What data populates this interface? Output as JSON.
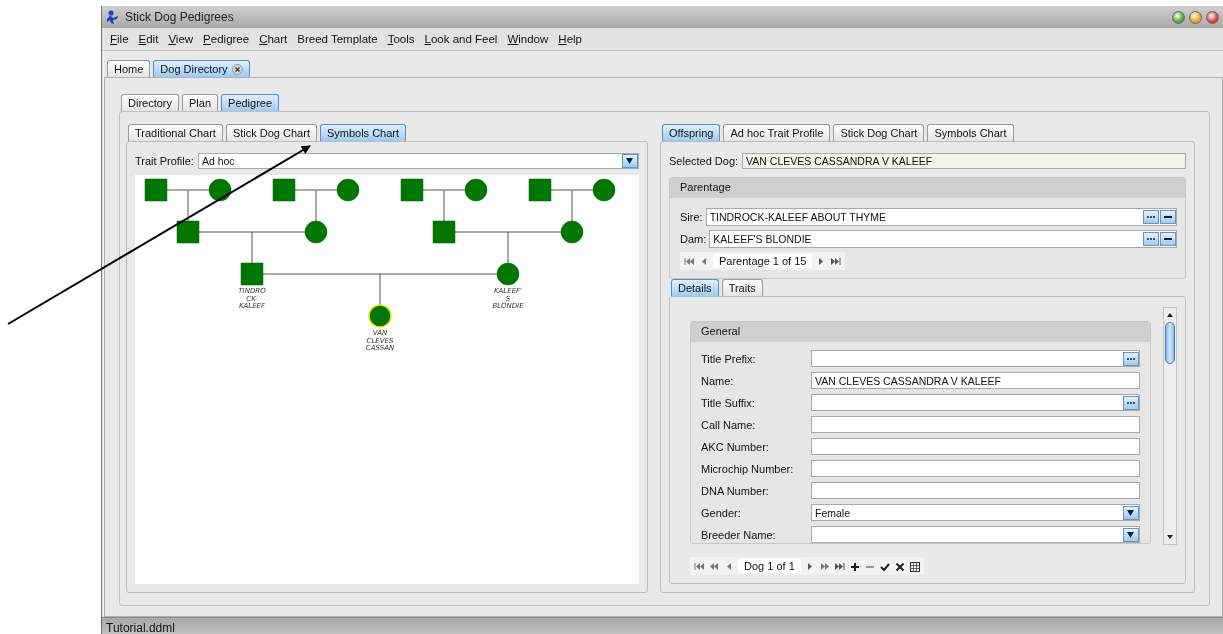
{
  "window": {
    "title": "Stick Dog Pedigrees"
  },
  "menu": [
    {
      "label": "File",
      "mnemonic": true
    },
    {
      "label": "Edit",
      "mnemonic": true
    },
    {
      "label": "View",
      "mnemonic": true
    },
    {
      "label": "Pedigree",
      "mnemonic": true
    },
    {
      "label": "Chart",
      "mnemonic": true
    },
    {
      "label": "Breed Template",
      "mnemonic": false
    },
    {
      "label": "Tools",
      "mnemonic": true
    },
    {
      "label": "Look and Feel",
      "mnemonic": true
    },
    {
      "label": "Window",
      "mnemonic": true
    },
    {
      "label": "Help",
      "mnemonic": true
    }
  ],
  "document_tabs": [
    {
      "label": "Home",
      "selected": false,
      "closable": false
    },
    {
      "label": "Dog Directory",
      "selected": true,
      "closable": true
    }
  ],
  "view_tabs": [
    {
      "label": "Directory",
      "selected": false
    },
    {
      "label": "Plan",
      "selected": false
    },
    {
      "label": "Pedigree",
      "selected": true
    }
  ],
  "chart_panel": {
    "tabs": [
      {
        "label": "Traditional Chart",
        "selected": false
      },
      {
        "label": "Stick Dog Chart",
        "selected": false
      },
      {
        "label": "Symbols Chart",
        "selected": true
      }
    ],
    "trait_profile": {
      "label": "Trait Profile:",
      "value": "Ad hoc"
    },
    "pedigree": {
      "kind": "female",
      "selected": true,
      "label_lines": [
        "VAN",
        "CLEVES",
        "CASSAN"
      ],
      "parents": [
        {
          "kind": "male",
          "selected": false,
          "label_lines": [
            "TINDRO",
            "CK-",
            "KALEEF"
          ],
          "parents": [
            {
              "kind": "male",
              "selected": false,
              "parents": [
                {
                  "kind": "male",
                  "selected": false
                },
                {
                  "kind": "female",
                  "selected": false
                }
              ]
            },
            {
              "kind": "female",
              "selected": false,
              "parents": [
                {
                  "kind": "male",
                  "selected": false
                },
                {
                  "kind": "female",
                  "selected": false
                }
              ]
            }
          ]
        },
        {
          "kind": "female",
          "selected": false,
          "label_lines": [
            "KALEEF'",
            "S",
            "BLONDIE"
          ],
          "parents": [
            {
              "kind": "male",
              "selected": false,
              "parents": [
                {
                  "kind": "male",
                  "selected": false
                },
                {
                  "kind": "female",
                  "selected": false
                }
              ]
            },
            {
              "kind": "female",
              "selected": false,
              "parents": [
                {
                  "kind": "male",
                  "selected": false
                },
                {
                  "kind": "female",
                  "selected": false
                }
              ]
            }
          ]
        }
      ]
    }
  },
  "detail_panel": {
    "tabs": [
      {
        "label": "Offspring",
        "selected": true
      },
      {
        "label": "Ad hoc Trait Profile",
        "selected": false
      },
      {
        "label": "Stick Dog Chart",
        "selected": false
      },
      {
        "label": "Symbols Chart",
        "selected": false
      }
    ],
    "selected_dog": {
      "label": "Selected Dog:",
      "value": "VAN CLEVES CASSANDRA V KALEEF"
    },
    "parentage": {
      "title": "Parentage",
      "fields": [
        {
          "label": "Sire:",
          "value": "TINDROCK-KALEEF ABOUT THYME"
        },
        {
          "label": "Dam:",
          "value": "KALEEF'S BLONDIE"
        }
      ],
      "navigator": "Parentage 1 of 15"
    },
    "sub_tabs": [
      {
        "label": "Details",
        "selected": true
      },
      {
        "label": "Traits",
        "selected": false
      }
    ],
    "general": {
      "title": "General",
      "fields": [
        {
          "label": "Title Prefix:",
          "kind": "lookup"
        },
        {
          "label": "Name:",
          "kind": "text",
          "value": "VAN CLEVES CASSANDRA V KALEEF"
        },
        {
          "label": "Title Suffix:",
          "kind": "lookup"
        },
        {
          "label": "Call Name:",
          "kind": "text"
        },
        {
          "label": "AKC Number:",
          "kind": "text"
        },
        {
          "label": "Microchip Number:",
          "kind": "text"
        },
        {
          "label": "DNA Number:",
          "kind": "text"
        },
        {
          "label": "Gender:",
          "kind": "combo",
          "value": "Female"
        },
        {
          "label": "Breeder Name:",
          "kind": "combo"
        }
      ]
    },
    "navigator": "Dog 1 of 1"
  },
  "status_bar": "Tutorial.ddml"
}
